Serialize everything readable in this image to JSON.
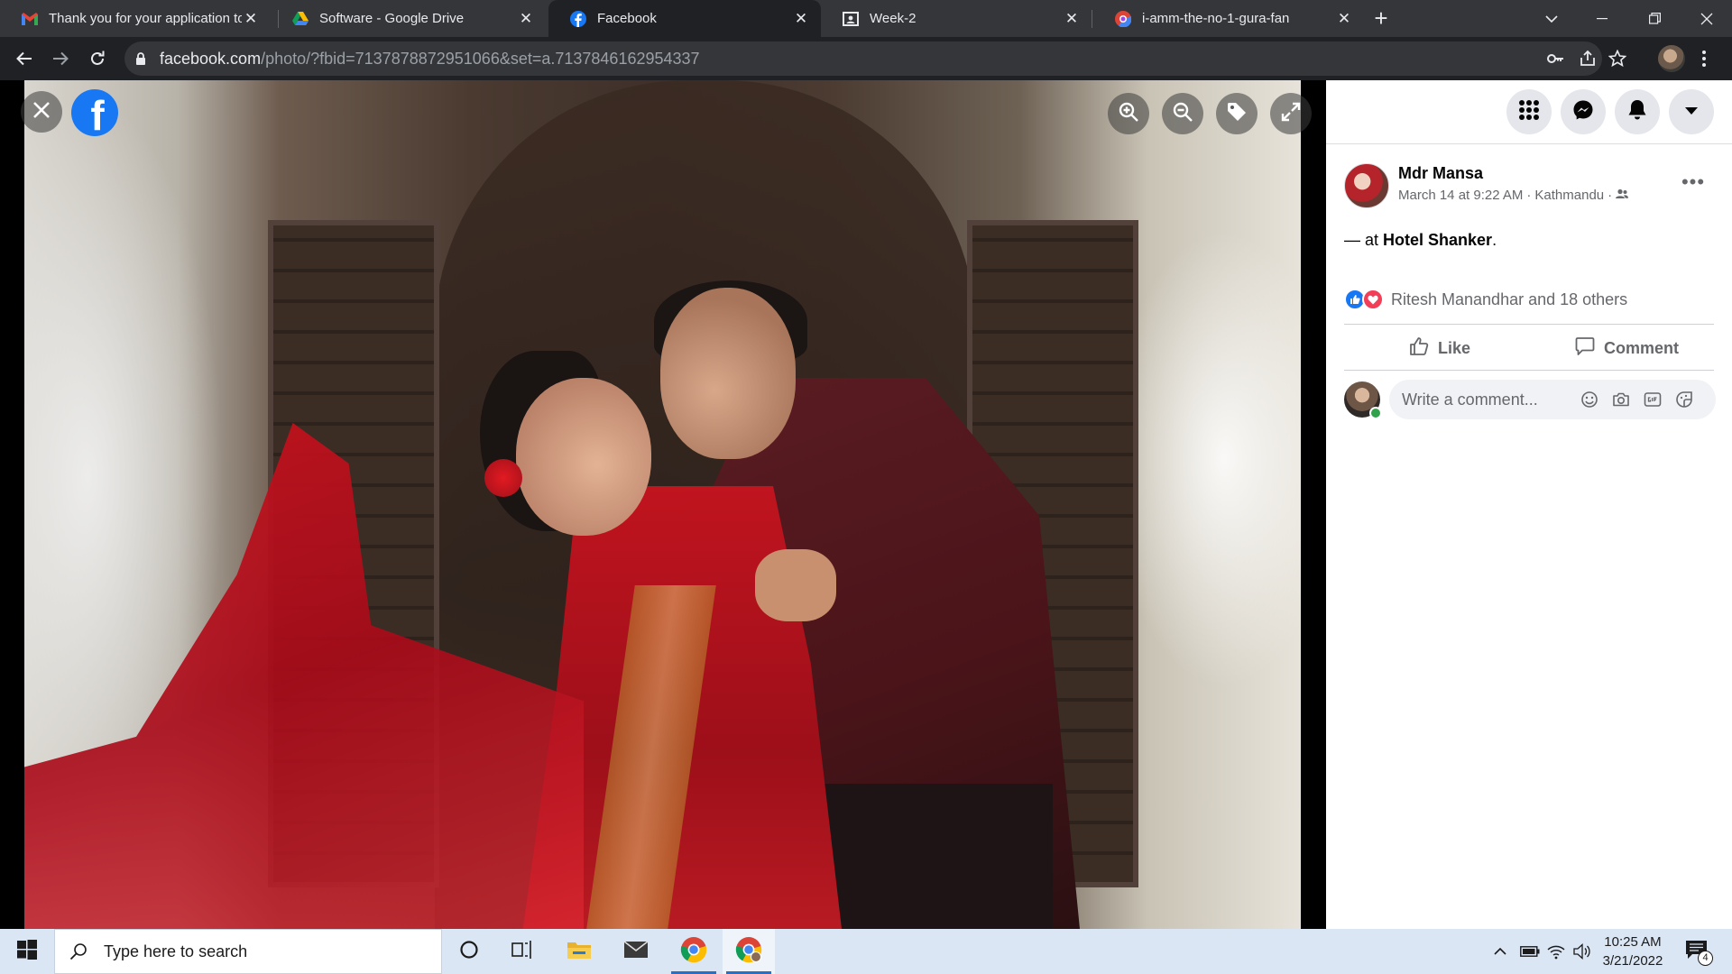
{
  "browser": {
    "tabs": [
      {
        "title": "Thank you for your application to",
        "favicon": "gmail-icon"
      },
      {
        "title": "Software - Google Drive",
        "favicon": "google-drive-icon"
      },
      {
        "title": "Facebook",
        "favicon": "facebook-icon",
        "active": true
      },
      {
        "title": "Week-2",
        "favicon": "classroom-icon"
      },
      {
        "title": "i-amm-the-no-1-gura-fan",
        "favicon": "chrome-app-icon"
      }
    ],
    "new_tab_label": "+",
    "url_host": "facebook.com",
    "url_path": "/photo/?fbid=7137878872951066&set=a.7137846162954337"
  },
  "viewer": {
    "close_icon": "close-icon",
    "logo": "facebook-logo",
    "logo_letter": "f",
    "tools": [
      "zoom-in-icon",
      "zoom-out-icon",
      "tag-icon",
      "fullscreen-icon"
    ]
  },
  "post": {
    "author": "Mdr Mansa",
    "date": "March 14 at 9:22 AM",
    "location": "Kathmandu",
    "separator": "·",
    "caption_prefix": "— at ",
    "caption_place": "Hotel Shanker",
    "caption_suffix": ".",
    "reactions_text": "Ritesh Manandhar and 18 others",
    "like_label": "Like",
    "comment_label": "Comment",
    "comment_placeholder": "Write a comment..."
  },
  "header_buttons": [
    "menu-grid-icon",
    "messenger-icon",
    "notifications-bell-icon",
    "account-dropdown-icon"
  ],
  "taskbar": {
    "search_placeholder": "Type here to search",
    "time": "10:25 AM",
    "date": "3/21/2022",
    "notification_count": "4"
  },
  "colors": {
    "facebook_blue": "#1877f2",
    "love_red": "#f33e58",
    "chrome_dark": "#202124",
    "online_green": "#31a24c"
  }
}
